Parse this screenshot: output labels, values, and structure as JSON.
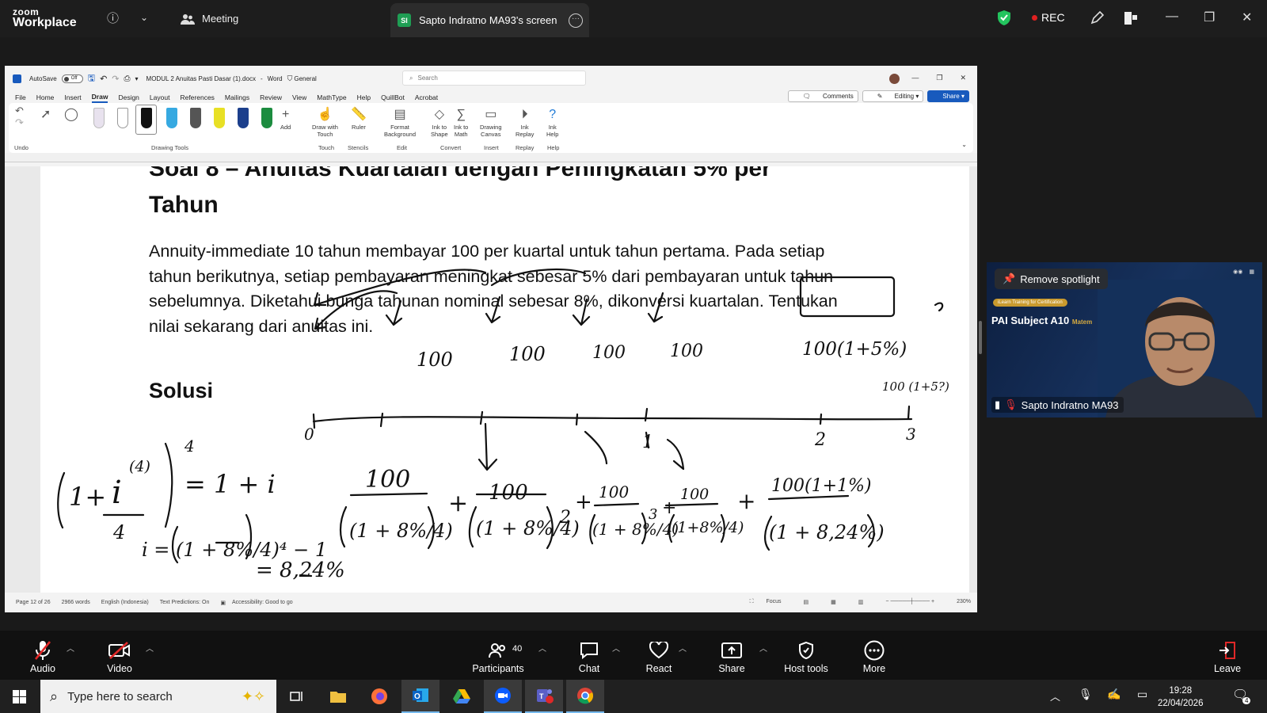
{
  "zoom": {
    "logo_top": "zoom",
    "logo_bottom": "Workplace",
    "meeting_label": "Meeting",
    "screen_tab_badge": "SI",
    "screen_tab_label": "Sapto Indratno MA93's screen",
    "rec_label": "REC",
    "accent": "#0b5cff"
  },
  "word": {
    "autosave_label": "AutoSave",
    "autosave_state": "Off",
    "filename": "MODUL 2 Anuitas Pasti Dasar (1).docx",
    "app_name": "Word",
    "sensitivity": "General",
    "search_placeholder": "Search",
    "menu": [
      "File",
      "Home",
      "Insert",
      "Draw",
      "Design",
      "Layout",
      "References",
      "Mailings",
      "Review",
      "View",
      "MathType",
      "Help",
      "QuillBot",
      "Acrobat"
    ],
    "active_menu": "Draw",
    "comments_label": "Comments",
    "editing_label": "Editing",
    "share_label": "Share",
    "ribbon": {
      "undo_group": "Undo",
      "drawing_tools_group": "Drawing Tools",
      "add_label": "Add",
      "draw_with_touch_1": "Draw with",
      "draw_with_touch_2": "Touch",
      "touch_group": "Touch",
      "ruler_label": "Ruler",
      "stencils_group": "Stencils",
      "format_bg_1": "Format",
      "format_bg_2": "Background",
      "edit_group": "Edit",
      "ink_shape_1": "Ink to",
      "ink_shape_2": "Shape",
      "ink_math_1": "Ink to",
      "ink_math_2": "Math",
      "convert_group": "Convert",
      "drawing_canvas_1": "Drawing",
      "drawing_canvas_2": "Canvas",
      "insert_group": "Insert",
      "ink_replay_1": "Ink",
      "ink_replay_2": "Replay",
      "replay_group": "Replay",
      "ink_help_1": "Ink",
      "ink_help_2": "Help",
      "help_group": "Help"
    },
    "doc": {
      "heading_line1": "Soal 8 – Anuitas Kuartalan dengan Peningkatan 5% per",
      "heading_line2": "Tahun",
      "paragraph": "Annuity-immediate 10 tahun membayar 100 per kuartal untuk tahun pertama. Pada setiap tahun berikutnya, setiap pembayaran meningkat sebesar 5% dari pembayaran untuk tahun sebelumnya. Diketahui bunga tahunan nominal sebesar 8%, dikonversi kuartalan. Tentukan nilai sekarang dari anuitas ini.",
      "solution_heading": "Solusi",
      "ink": {
        "payments": [
          "100",
          "100",
          "100",
          "100"
        ],
        "boxed_payment": "100(1+5%)",
        "side_payment": "100 (1+5?)",
        "timeline_labels": [
          "0",
          "1",
          "2",
          "3"
        ],
        "eq_rhs": "= 1 + i",
        "eq_i": "i = (1 + 8%/4)⁴ − 1",
        "eq_result": "= 8,24%",
        "term_numerators": [
          "100",
          "100",
          "100",
          "100",
          "100(1+1%)"
        ],
        "term_denominators": [
          "(1 + 8%/4)",
          "(1 + 8%/4)",
          "(1 + 8%/4)",
          "(1+8%/4)",
          "(1 + 8,24%)"
        ],
        "exponents": [
          "2",
          "3"
        ],
        "frac_quarter": "4",
        "sup_4": "(4)",
        "plus": "+"
      }
    },
    "status": {
      "page": "Page 12 of 26",
      "words": "2966 words",
      "language": "English (Indonesia)",
      "predictions": "Text Predictions: On",
      "accessibility": "Accessibility: Good to go",
      "focus": "Focus",
      "zoom_level": "230%"
    }
  },
  "spotlight": {
    "remove_label": "Remove spotlight",
    "banner_tag": "iLearn Training for Certification",
    "banner_title": "PAI Subject A10",
    "banner_sub": "Matem",
    "participant_name": "Sapto Indratno MA93"
  },
  "controls": {
    "audio": "Audio",
    "video": "Video",
    "participants": "Participants",
    "participant_count": "40",
    "chat": "Chat",
    "react": "React",
    "share": "Share",
    "host_tools": "Host tools",
    "more": "More",
    "leave": "Leave"
  },
  "taskbar": {
    "search_placeholder": "Type here to search",
    "time": "19:28",
    "date": "22/04/2026",
    "notification_count": "4"
  }
}
